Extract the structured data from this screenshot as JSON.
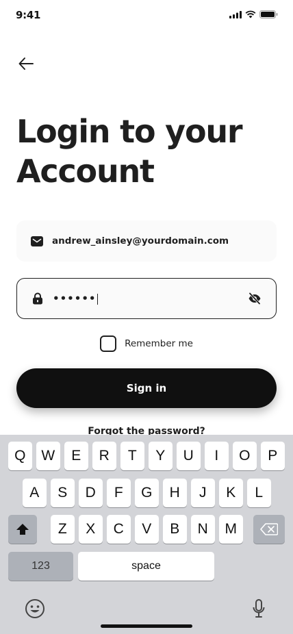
{
  "status_bar": {
    "time": "9:41"
  },
  "header": {
    "title_line1": "Login to your",
    "title_line2": "Account"
  },
  "form": {
    "email_value": "andrew_ainsley@yourdomain.com",
    "password_value": "••••••",
    "remember_label": "Remember me",
    "signin_label": "Sign in",
    "forgot_label": "Forgot the password?"
  },
  "keyboard": {
    "row1": [
      "Q",
      "W",
      "E",
      "R",
      "T",
      "Y",
      "U",
      "I",
      "O",
      "P"
    ],
    "row2": [
      "A",
      "S",
      "D",
      "F",
      "G",
      "H",
      "J",
      "K",
      "L"
    ],
    "row3": [
      "Z",
      "X",
      "C",
      "V",
      "B",
      "N",
      "M"
    ],
    "numbers_label": "123",
    "space_label": "space"
  },
  "icons": {
    "back": "arrow-left-icon",
    "email": "mail-icon",
    "password": "lock-icon",
    "toggle": "eye-off-icon",
    "shift": "shift-icon",
    "delete": "backspace-icon",
    "emoji": "emoji-icon",
    "mic": "microphone-icon"
  },
  "colors": {
    "primary": "#101010",
    "field_bg": "#fafafa",
    "keyboard_bg": "#d3d4d8"
  }
}
